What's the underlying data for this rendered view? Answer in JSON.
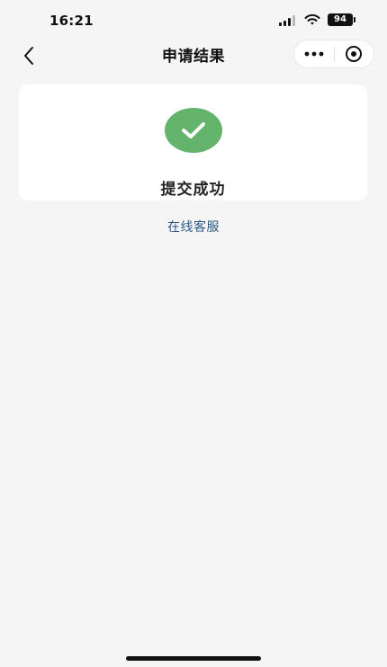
{
  "status_bar": {
    "time": "16:21",
    "battery": "94"
  },
  "nav": {
    "title": "申请结果",
    "more_icon": "more-dots-icon",
    "close_icon": "close-circle-icon",
    "back_icon": "chevron-left-icon"
  },
  "result": {
    "icon": "check-icon",
    "message": "提交成功"
  },
  "links": {
    "online_service": "在线客服"
  },
  "colors": {
    "success": "#63b36b",
    "link": "#2b5a8a",
    "background": "#f5f5f5"
  }
}
